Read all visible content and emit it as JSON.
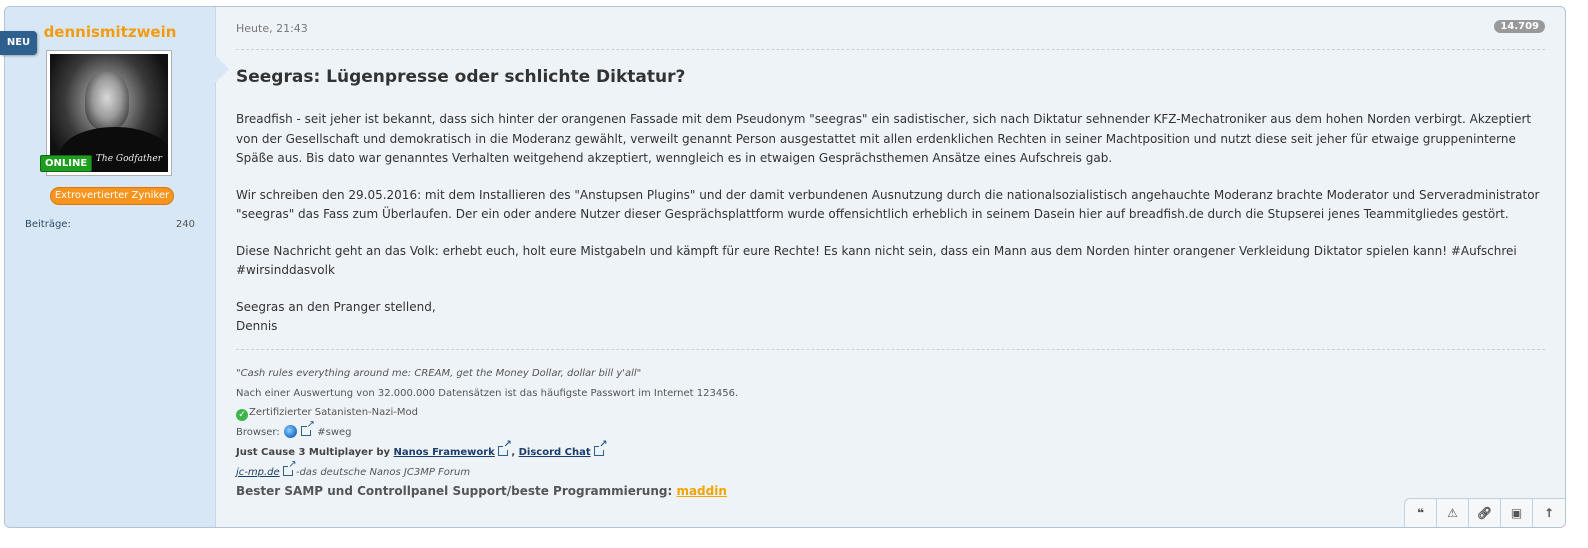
{
  "badge_new": "NEU",
  "author": {
    "username": "dennismitzwein",
    "avatar_caption": "The Godfather",
    "status": "ONLINE",
    "rank": "Extrovertierter Zyniker",
    "stats_label": "Beiträge:",
    "stats_value": "240"
  },
  "post": {
    "time": "Heute, 21:43",
    "number": "14.709",
    "title": "Seegras: Lügenpresse oder schlichte Diktatur?",
    "paragraphs": [
      "Breadfish - seit jeher ist bekannt, dass sich hinter der orangenen Fassade mit dem Pseudonym \"seegras\" ein sadistischer, sich nach Diktatur sehnender KFZ-Mechatroniker aus dem hohen Norden verbirgt. Akzeptiert von der Gesellschaft und demokratisch in die Moderanz gewählt, verweilt genannt Person ausgestattet mit allen erdenklichen Rechten in seiner Machtposition und nutzt diese seit jeher für etwaige gruppeninterne Späße aus. Bis dato war genanntes Verhalten weitgehend akzeptiert, wenngleich es in etwaigen Gesprächsthemen Ansätze eines Aufschreis gab.",
      "Wir schreiben den 29.05.2016: mit dem Installieren des \"Anstupsen Plugins\" und der damit verbundenen Ausnutzung durch die nationalsozialistisch angehauchte Moderanz brachte Moderator und Serveradministrator \"seegras\" das Fass zum Überlaufen. Der ein oder andere Nutzer dieser Gesprächsplattform wurde offensichtlich erheblich in seinem Dasein hier auf breadfish.de durch die Stupserei jenes Teammitgliedes gestört.",
      "Diese Nachricht geht an das Volk: erhebt euch, holt eure Mistgabeln und kämpft für eure Rechte! Es kann nicht sein, dass ein Mann aus dem Norden hinter orangener Verkleidung Diktator spielen kann! #Aufschrei #wirsinddasvolk"
    ],
    "closing_line1": "Seegras an den Pranger stellend,",
    "closing_line2": "Dennis"
  },
  "signature": {
    "quote": "\"Cash rules everything around me: CREAM, get the Money Dollar, dollar bill y'all\"",
    "fact": "Nach einer Auswertung von 32.000.000 Datensätzen ist das häufigste Passwort im Internet 123456.",
    "certified": "Zertifizierter Satanisten-Nazi-Mod",
    "browser_label": "Browser:",
    "browser_tag": "#sweg",
    "jc3_prefix": "Just Cause 3 Multiplayer by",
    "nanos_link": "Nanos Framework",
    "separator": ",",
    "discord_link": "Discord Chat",
    "jcmp_link": "jc-mp.de",
    "jcmp_suffix": "-das deutsche Nanos JC3MP Forum",
    "support_text": "Bester SAMP und Controllpanel Support/beste Programmierung:",
    "support_link": "maddin"
  },
  "toolbar": {
    "quote_icon": "quote-icon",
    "report_icon": "warning-icon",
    "link_icon": "link-icon",
    "image_icon": "image-icon",
    "top_icon": "arrow-up-icon"
  }
}
